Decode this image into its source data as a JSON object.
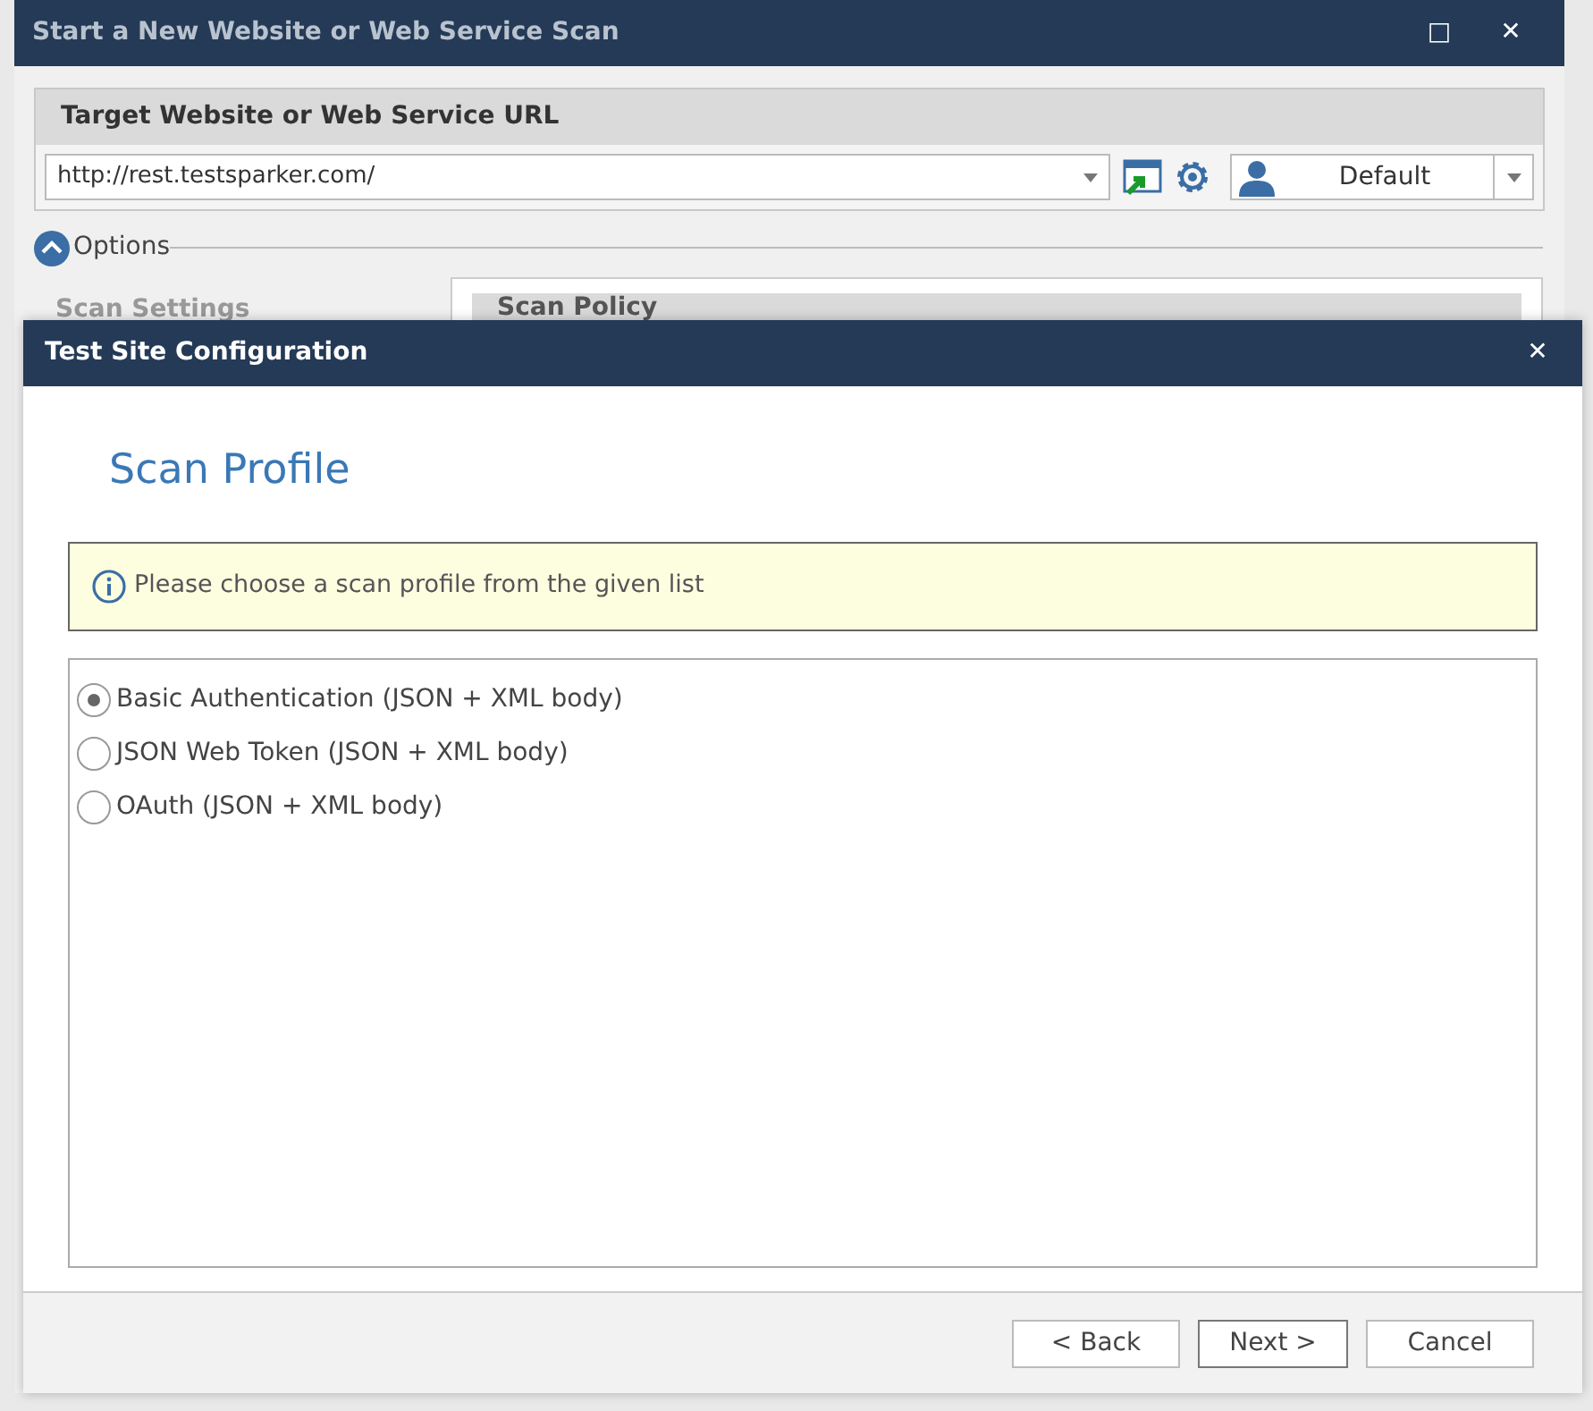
{
  "main_window": {
    "title": "Start a New Website or Web Service Scan",
    "controls": [
      "□",
      "✕"
    ],
    "target": {
      "heading": "Target Website or Web Service URL",
      "url": "http://rest.testsparker.com/",
      "profile": "Default"
    },
    "options": {
      "label": "Options",
      "expanded": true
    },
    "scan_settings": "Scan Settings",
    "scan_policy": "Scan Policy"
  },
  "dialog": {
    "title": "Test Site Configuration",
    "close": "✕",
    "heading": "Scan Profile",
    "info": "Please choose a scan profile from the given list",
    "profiles": [
      {
        "label": "Basic Authentication (JSON + XML body)",
        "selected": true
      },
      {
        "label": "JSON Web Token (JSON + XML body)",
        "selected": false
      },
      {
        "label": "OAuth (JSON + XML body)",
        "selected": false
      }
    ],
    "buttons": [
      {
        "label": "< Back",
        "kind": "normal"
      },
      {
        "label": "Next >",
        "kind": "default"
      },
      {
        "label": "Cancel",
        "kind": "normal"
      }
    ]
  }
}
